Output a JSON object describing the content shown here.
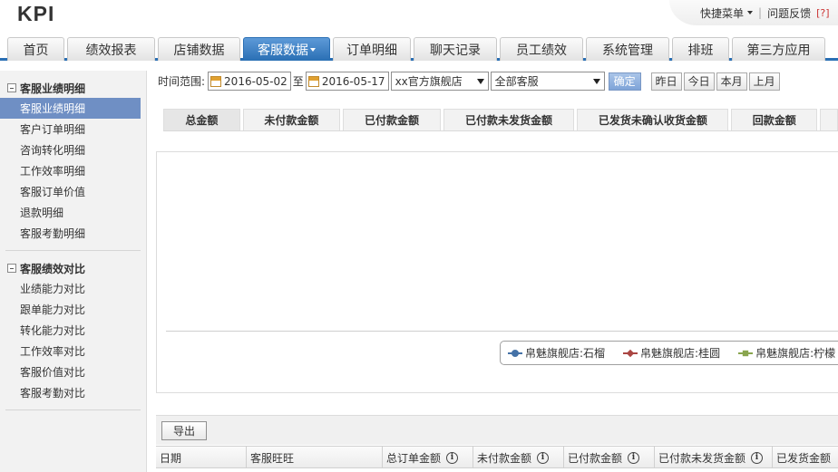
{
  "app": {
    "logo": "KPI"
  },
  "header": {
    "quick_menu": "快捷菜单",
    "separator": "|",
    "feedback": "问题反馈",
    "help": "[?]"
  },
  "nav": {
    "tabs": [
      {
        "label": "首页"
      },
      {
        "label": "绩效报表"
      },
      {
        "label": "店铺数据"
      },
      {
        "label": "客服数据"
      },
      {
        "label": "订单明细"
      },
      {
        "label": "聊天记录"
      },
      {
        "label": "员工绩效"
      },
      {
        "label": "系统管理"
      },
      {
        "label": "排班"
      },
      {
        "label": "第三方应用"
      }
    ],
    "active_index": 3
  },
  "sidebar": {
    "groups": [
      {
        "title": "客服业绩明细",
        "items": [
          "客服业绩明细",
          "客户订单明细",
          "咨询转化明细",
          "工作效率明细",
          "客服订单价值",
          "退款明细",
          "客服考勤明细"
        ]
      },
      {
        "title": "客服绩效对比",
        "items": [
          "业绩能力对比",
          "跟单能力对比",
          "转化能力对比",
          "工作效率对比",
          "客服价值对比",
          "客服考勤对比"
        ]
      }
    ],
    "active_item": "客服业绩明细"
  },
  "toolbar": {
    "range_label": "时间范围:",
    "start_date": "2016-05-02",
    "to_label": "至",
    "end_date": "2016-05-17",
    "shop_select": "xx官方旗舰店",
    "staff_select": "全部客服",
    "confirm": "确定",
    "quick": [
      "昨日",
      "今日",
      "本月",
      "上月"
    ]
  },
  "metric_tabs": [
    "总金额",
    "未付款金额",
    "已付款金额",
    "已付款未发货金额",
    "已发货未确认收货金额",
    "回款金额"
  ],
  "chart_legend": [
    {
      "name": "帛魅旗舰店:石榴",
      "color": "#4572a7"
    },
    {
      "name": "帛魅旗舰店:桂圆",
      "color": "#aa4643"
    },
    {
      "name": "帛魅旗舰店:柠檬",
      "color": "#89a54e"
    }
  ],
  "export": {
    "label": "导出"
  },
  "table": {
    "columns": [
      {
        "label": "日期",
        "info": false
      },
      {
        "label": "客服旺旺",
        "info": false
      },
      {
        "label": "总订单金额",
        "info": true
      },
      {
        "label": "未付款金额",
        "info": true
      },
      {
        "label": "已付款金额",
        "info": true
      },
      {
        "label": "已付款未发货金额",
        "info": true
      },
      {
        "label": "已发货金额",
        "info": false
      }
    ]
  }
}
